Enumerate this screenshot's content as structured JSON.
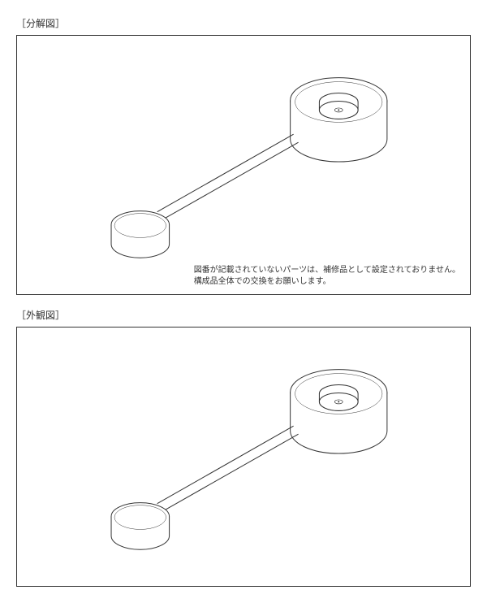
{
  "section1": {
    "title": "［分解図］",
    "note_line1": "図番が記載されていないパーツは、補修品として設定されておりません。",
    "note_line2": "構成品全体での交換をお願いします。"
  },
  "section2": {
    "title": "［外観図］"
  }
}
